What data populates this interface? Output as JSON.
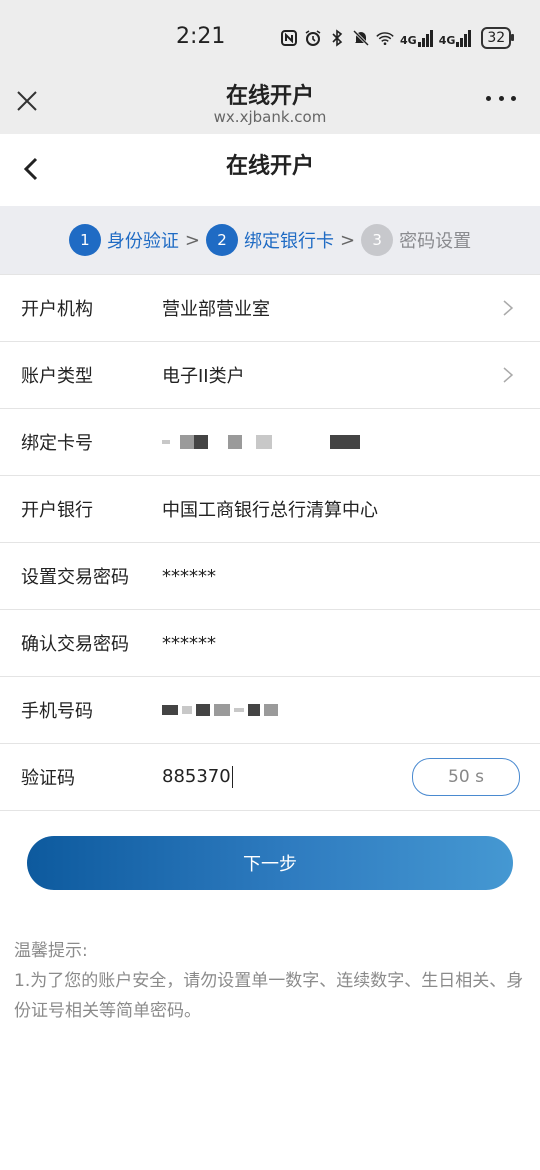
{
  "status": {
    "time": "2:21",
    "signal_labels": [
      "4G",
      "4G"
    ],
    "battery": "32"
  },
  "browser": {
    "title": "在线开户",
    "url": "wx.xjbank.com"
  },
  "header": {
    "title": "在线开户"
  },
  "steps": [
    {
      "num": "1",
      "label": "身份验证",
      "state": "active"
    },
    {
      "num": "2",
      "label": "绑定银行卡",
      "state": "active"
    },
    {
      "num": "3",
      "label": "密码设置",
      "state": "inactive"
    }
  ],
  "step_separator": ">",
  "form": {
    "institution": {
      "label": "开户机构",
      "value": "营业部营业室"
    },
    "account_type": {
      "label": "账户类型",
      "value": "电子II类户"
    },
    "card_number": {
      "label": "绑定卡号"
    },
    "bank": {
      "label": "开户银行",
      "value": "中国工商银行总行清算中心"
    },
    "trade_password": {
      "label": "设置交易密码",
      "value": "******"
    },
    "confirm_password": {
      "label": "确认交易密码",
      "value": "******"
    },
    "phone": {
      "label": "手机号码"
    },
    "verify_code": {
      "label": "验证码",
      "value": "885370",
      "countdown": "50 s"
    }
  },
  "next_button": "下一步",
  "tips": {
    "title": "温馨提示:",
    "line1": "1.为了您的账户安全，请勿设置单一数字、连续数字、生日相关、身份证号相关等简单密码。"
  },
  "colors": {
    "accent": "#1f6bc4",
    "step_inactive": "#c7c8cc",
    "button_gradient_start": "#0d5a9e",
    "button_gradient_end": "#4598d2"
  }
}
